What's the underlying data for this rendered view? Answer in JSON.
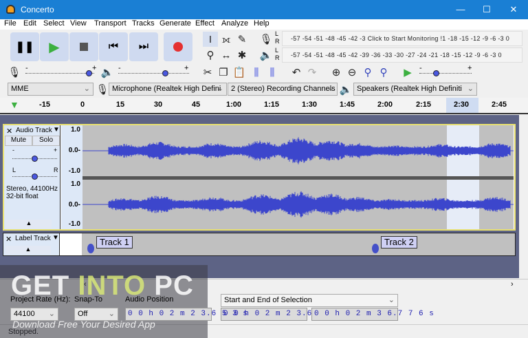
{
  "window": {
    "title": "Concerto",
    "min": "—",
    "max": "☐",
    "close": "✕"
  },
  "menu": [
    "File",
    "Edit",
    "Select",
    "View",
    "Transport",
    "Tracks",
    "Generate",
    "Effect",
    "Analyze",
    "Help"
  ],
  "meters": {
    "record": "-57 -54 -51 -48 -45 -42 -3  Click to Start Monitoring !1 -18 -15 -12  -9  -6  -3  0",
    "playback": "-57 -54 -51 -48 -45 -42 -39 -36 -33 -30 -27 -24 -21 -18 -15 -12  -9  -6  -3  0",
    "L": "L",
    "R": "R"
  },
  "sliders": {
    "minus": "-",
    "plus": "+"
  },
  "devices": {
    "host": "MME",
    "mic": "Microphone (Realtek High Defini",
    "channels": "2 (Stereo) Recording Channels",
    "speakers": "Speakers (Realtek High Definiti"
  },
  "ruler": [
    "-15",
    "0",
    "15",
    "30",
    "45",
    "1:00",
    "1:15",
    "1:30",
    "1:45",
    "2:00",
    "2:15",
    "2:30",
    "2:45"
  ],
  "audio_track": {
    "name": "Audio Track",
    "mute": "Mute",
    "solo": "Solo",
    "gain_minus": "-",
    "gain_plus": "+",
    "pan_l": "L",
    "pan_r": "R",
    "info1": "Stereo, 44100Hz",
    "info2": "32-bit float",
    "scale": [
      "1.0",
      "0.0-",
      "-1.0"
    ]
  },
  "label_track": {
    "name": "Label Track",
    "labels": [
      "Track 1",
      "Track 2"
    ]
  },
  "selection_toolbar": {
    "rate_label": "Project Rate (Hz):",
    "rate": "44100",
    "snap_label": "Snap-To",
    "snap": "Off",
    "pos_label": "Audio Position",
    "position": "0 0 h 0 2 m 2 3.6 5 3 s",
    "sel_mode": "Start and End of Selection",
    "sel_start": "0 0 h 0 2 m 2 3.6 5 3 s",
    "sel_end": "0 0 h 0 2 m 3 6.7 7 6 s"
  },
  "status": "Stopped.",
  "watermark": {
    "line1a": "GET ",
    "line1b": "INTO",
    "line1c": " PC",
    "line2": "Download Free Your Desired App"
  }
}
